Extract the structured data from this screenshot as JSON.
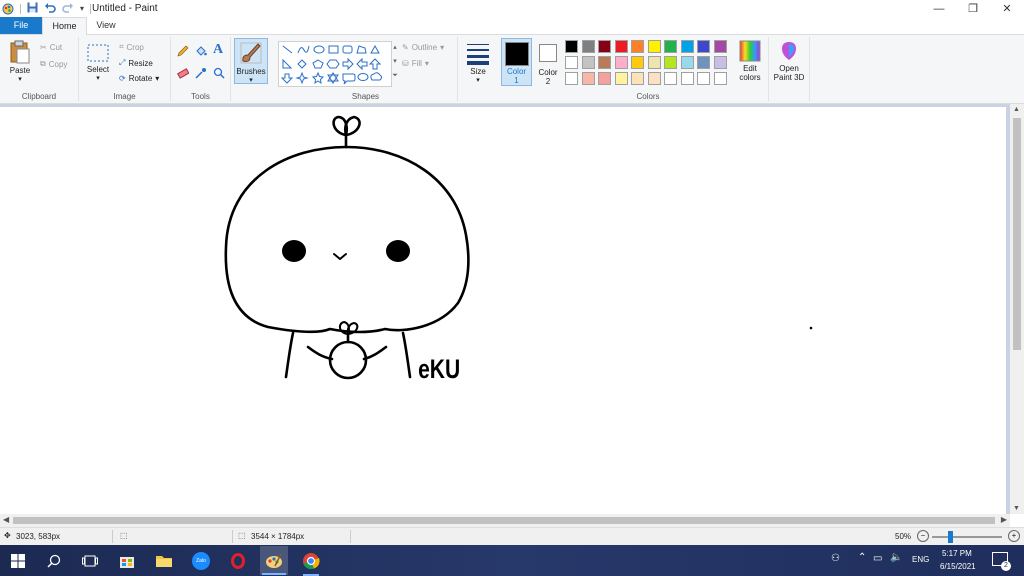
{
  "window": {
    "title": "Untitled - Paint"
  },
  "tabs": {
    "file": "File",
    "home": "Home",
    "view": "View"
  },
  "clipboard": {
    "paste": "Paste",
    "cut": "Cut",
    "copy": "Copy",
    "label": "Clipboard"
  },
  "image": {
    "select": "Select",
    "crop": "Crop",
    "resize": "Resize",
    "rotate": "Rotate",
    "label": "Image"
  },
  "tools": {
    "label": "Tools",
    "text_tool": "A"
  },
  "brushes": {
    "label": "Brushes"
  },
  "shapes": {
    "outline": "Outline",
    "fill": "Fill",
    "label": "Shapes"
  },
  "size": {
    "label": "Size"
  },
  "color1": {
    "label": "Color",
    "num": "1",
    "value": "#000000"
  },
  "color2": {
    "label": "Color",
    "num": "2",
    "value": "#ffffff"
  },
  "palette": {
    "row1": [
      "#000000",
      "#7f7f7f",
      "#880015",
      "#ed1c24",
      "#ff7f27",
      "#fff200",
      "#22b14c",
      "#00a2e8",
      "#3f48cc",
      "#a349a4"
    ],
    "row2": [
      "#ffffff",
      "#c3c3c3",
      "#b97a57",
      "#ffaec9",
      "#ffc90e",
      "#efe4b0",
      "#b5e61d",
      "#99d9ea",
      "#7092be",
      "#c8bfe7"
    ],
    "row3": [
      "#ffffff",
      "#f7b6a6",
      "#f5a09c",
      "#fff3a0",
      "#fde2b8",
      "#fbe0c3",
      "#ffffff",
      "#ffffff",
      "#ffffff",
      "#ffffff"
    ]
  },
  "colors_group": {
    "label": "Colors"
  },
  "edit_colors": {
    "line1": "Edit",
    "line2": "colors"
  },
  "paint3d": {
    "line1": "Open",
    "line2": "Paint 3D"
  },
  "drawing": {
    "signature": "eKU"
  },
  "status": {
    "cursor": "3023, 583px",
    "size": "3544 × 1784px",
    "zoom": "50%",
    "zoom_level": 0.5
  },
  "taskbar": {
    "lang": "ENG",
    "time": "5:17 PM",
    "date": "6/15/2021",
    "notifications": "2",
    "zalo": "Zalo"
  }
}
